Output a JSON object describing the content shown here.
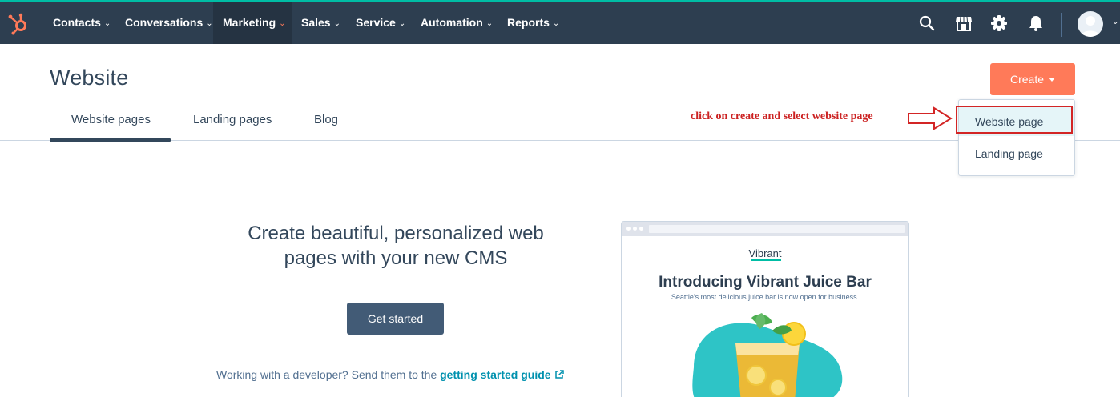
{
  "nav": {
    "items": [
      {
        "label": "Contacts"
      },
      {
        "label": "Conversations"
      },
      {
        "label": "Marketing"
      },
      {
        "label": "Sales"
      },
      {
        "label": "Service"
      },
      {
        "label": "Automation"
      },
      {
        "label": "Reports"
      }
    ],
    "chevron": "⌄",
    "icons": [
      "search-icon",
      "marketplace-icon",
      "settings-icon",
      "notifications-icon"
    ],
    "colors": {
      "bar": "#2d3e50",
      "accent": "#ff7a59",
      "teal": "#00bda5"
    }
  },
  "header": {
    "title": "Website",
    "create_label": "Create"
  },
  "tabs": [
    {
      "label": "Website pages"
    },
    {
      "label": "Landing pages"
    },
    {
      "label": "Blog"
    }
  ],
  "annotation": {
    "text": "click on create and select website page",
    "color": "#cc2222"
  },
  "dropdown": {
    "items": [
      {
        "label": "Website page"
      },
      {
        "label": "Landing page"
      }
    ]
  },
  "empty_state": {
    "headline_line1": "Create beautiful, personalized web",
    "headline_line2": "pages with your new CMS",
    "button_label": "Get started",
    "dev_text": "Working with a developer? Send them to the ",
    "dev_link": "getting started guide"
  },
  "preview": {
    "brand": "Vibrant",
    "title": "Introducing Vibrant Juice Bar",
    "subtitle": "Seattle's most delicious juice bar is now open for business."
  }
}
